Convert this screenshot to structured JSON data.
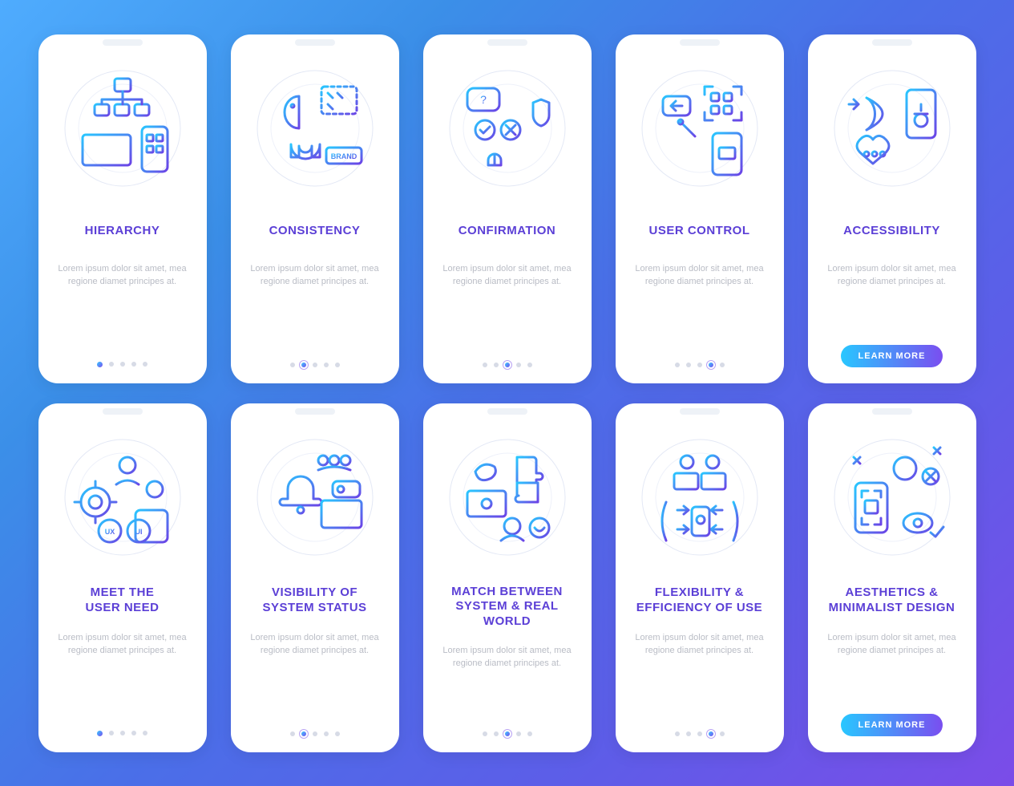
{
  "lorem": "Lorem ipsum dolor sit amet, mea regione diamet principes at.",
  "cta_label": "LEARN MORE",
  "dot_count": 5,
  "cards": [
    {
      "title": "HIERARCHY",
      "active_dot": 0,
      "cta": false,
      "icon": "hierarchy-icon"
    },
    {
      "title": "CONSISTENCY",
      "active_dot": 1,
      "cta": false,
      "icon": "consistency-icon"
    },
    {
      "title": "CONFIRMATION",
      "active_dot": 2,
      "cta": false,
      "icon": "confirmation-icon"
    },
    {
      "title": "USER CONTROL",
      "active_dot": 3,
      "cta": false,
      "icon": "user-control-icon"
    },
    {
      "title": "ACCESSIBILITY",
      "active_dot": 4,
      "cta": true,
      "icon": "accessibility-icon"
    },
    {
      "title": "MEET THE\nUSER NEED",
      "active_dot": 0,
      "cta": false,
      "icon": "user-need-icon"
    },
    {
      "title": "VISIBILITY OF\nSYSTEM STATUS",
      "active_dot": 1,
      "cta": false,
      "icon": "system-status-icon"
    },
    {
      "title": "MATCH BETWEEN\nSYSTEM & REAL WORLD",
      "active_dot": 2,
      "cta": false,
      "icon": "match-system-icon"
    },
    {
      "title": "FLEXIBILITY &\nEFFICIENCY OF USE",
      "active_dot": 3,
      "cta": false,
      "icon": "flexibility-icon"
    },
    {
      "title": "AESTHETICS &\nMINIMALIST DESIGN",
      "active_dot": 4,
      "cta": true,
      "icon": "minimalist-icon"
    }
  ]
}
